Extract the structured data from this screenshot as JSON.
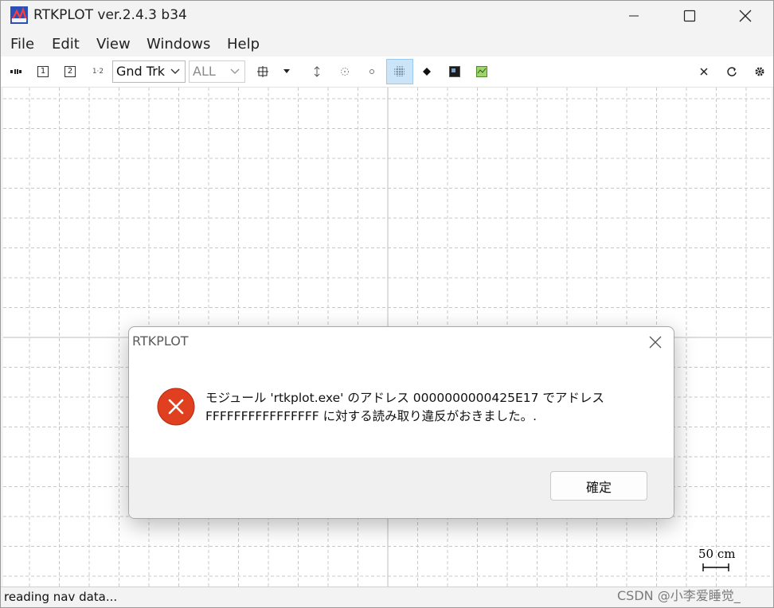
{
  "window": {
    "title": "RTKPLOT ver.2.4.3 b34"
  },
  "menu": [
    "File",
    "Edit",
    "View",
    "Windows",
    "Help"
  ],
  "toolbar": {
    "plot_type": "Gnd Trk",
    "satellite_filter": "ALL",
    "button_1": "1",
    "button_2": "2",
    "button_12": "1·2"
  },
  "plot": {
    "scale_label": "50 cm"
  },
  "status": {
    "text": "reading nav data..."
  },
  "watermark": "CSDN @小李爱睡觉_",
  "dialog": {
    "title": "RTKPLOT",
    "message_line1": "モジュール 'rtkplot.exe' のアドレス 0000000000425E17 でアドレス",
    "message_line2": "FFFFFFFFFFFFFFFF に対する読み取り違反がおきました。.",
    "ok_label": "確定"
  },
  "colors": {
    "error_red": "#e0401f",
    "active_toolbar": "#cce4f7",
    "grid_line": "#c8c8c8"
  }
}
